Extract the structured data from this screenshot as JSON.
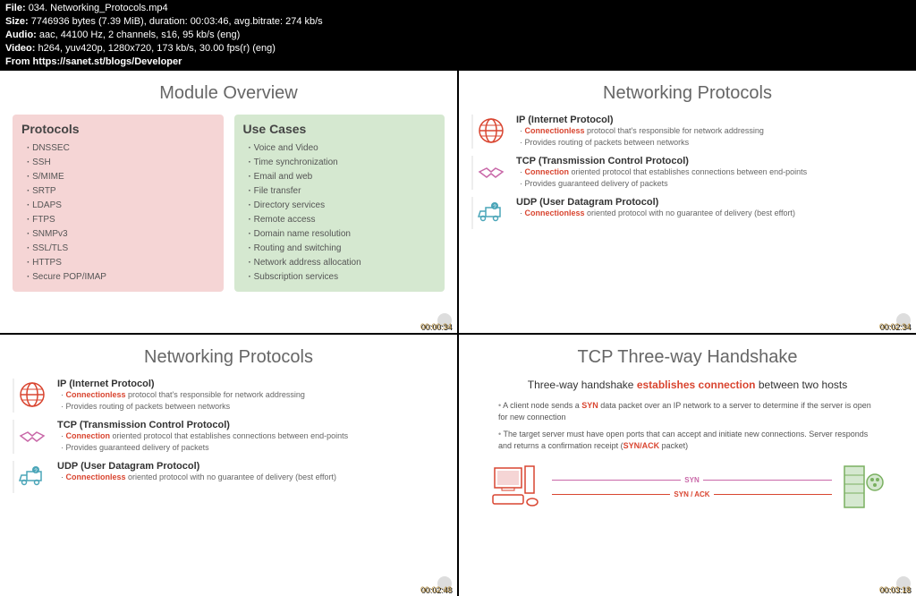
{
  "header": {
    "file_label": "File:",
    "file": "034. Networking_Protocols.mp4",
    "size_label": "Size:",
    "size": "7746936 bytes (7.39 MiB), duration: 00:03:46, avg.bitrate: 274 kb/s",
    "audio_label": "Audio:",
    "audio": "aac, 44100 Hz, 2 channels, s16, 95 kb/s (eng)",
    "video_label": "Video:",
    "video": "h264, yuv420p, 1280x720, 173 kb/s, 30.00 fps(r) (eng)",
    "from": "From https://sanet.st/blogs/Developer"
  },
  "slides": {
    "s1": {
      "title": "Module Overview",
      "col1_title": "Protocols",
      "col1": [
        "DNSSEC",
        "SSH",
        "S/MIME",
        "SRTP",
        "LDAPS",
        "FTPS",
        "SNMPv3",
        "SSL/TLS",
        "HTTPS",
        "Secure POP/IMAP"
      ],
      "col2_title": "Use Cases",
      "col2": [
        "Voice and Video",
        "Time synchronization",
        "Email and web",
        "File transfer",
        "Directory services",
        "Remote access",
        "Domain name resolution",
        "Routing and switching",
        "Network address allocation",
        "Subscription services"
      ],
      "ts": "00:00:34"
    },
    "s2": {
      "title": "Networking Protocols",
      "ip_h": "IP (Internet Protocol)",
      "ip_1a": "Connectionless",
      "ip_1b": " protocol that's responsible for network addressing",
      "ip_2": "Provides routing of packets between networks",
      "tcp_h": "TCP (Transmission Control Protocol)",
      "tcp_1a": "Connection",
      "tcp_1b": " oriented protocol that establishes connections between end-points",
      "tcp_2": "Provides guaranteed delivery of packets",
      "udp_h": "UDP (User Datagram Protocol)",
      "udp_1a": "Connectionless",
      "udp_1b": " oriented protocol with no guarantee of delivery (best effort)",
      "ts": "00:02:34"
    },
    "s3": {
      "title": "Networking Protocols",
      "ts": "00:02:48"
    },
    "s4": {
      "title": "TCP Three-way Handshake",
      "sub_a": "Three-way handshake ",
      "sub_b": "establishes connection",
      "sub_c": " between two hosts",
      "p1a": "A client node sends a ",
      "p1b": "SYN",
      "p1c": " data packet over an IP network to a server to determine if the server is open for new connection",
      "p2a": "The target server must have open ports that can accept and initiate new connections.   Server responds and returns a confirmation receipt (",
      "p2b": "SYN/ACK",
      "p2c": " packet)",
      "syn": "SYN",
      "synack": "SYN / ACK",
      "ts": "00:03:18"
    }
  }
}
